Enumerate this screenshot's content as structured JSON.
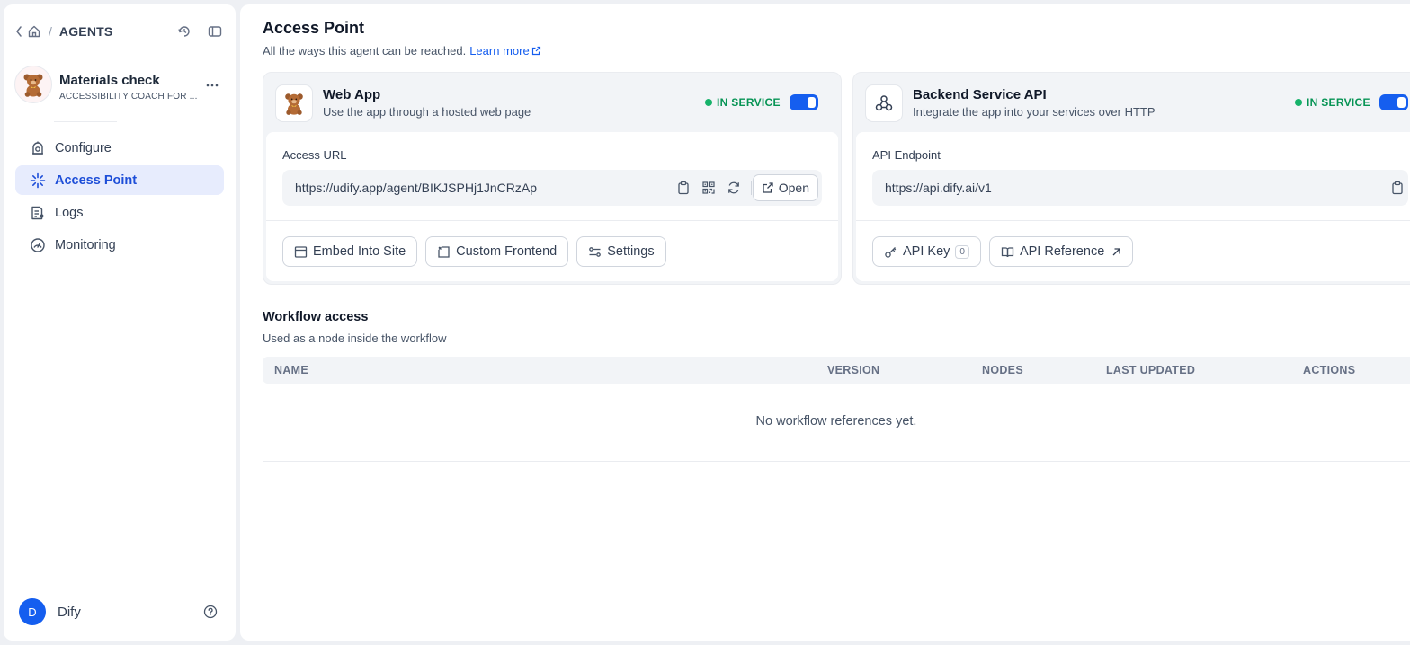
{
  "breadcrumb": {
    "section": "AGENTS"
  },
  "app": {
    "name": "Materials check",
    "subtitle": "ACCESSIBILITY COACH FOR ..."
  },
  "nav": [
    {
      "label": "Configure"
    },
    {
      "label": "Access Point"
    },
    {
      "label": "Logs"
    },
    {
      "label": "Monitoring"
    }
  ],
  "user": {
    "initial": "D",
    "name": "Dify"
  },
  "page": {
    "title": "Access Point",
    "description": "All the ways this agent can be reached.",
    "learn_more": "Learn more"
  },
  "web_app": {
    "title": "Web App",
    "subtitle": "Use the app through a hosted web page",
    "status": "IN SERVICE",
    "enabled": true,
    "field_label": "Access URL",
    "url": "https://udify.app/agent/BIKJSPHj1JnCRzAp",
    "open_label": "Open",
    "buttons": {
      "embed": "Embed Into Site",
      "custom_frontend": "Custom Frontend",
      "settings": "Settings"
    }
  },
  "backend_api": {
    "title": "Backend Service API",
    "subtitle": "Integrate the app into your services over HTTP",
    "status": "IN SERVICE",
    "enabled": true,
    "field_label": "API Endpoint",
    "endpoint": "https://api.dify.ai/v1",
    "buttons": {
      "api_key": "API Key",
      "api_key_count": "0",
      "api_reference": "API Reference"
    }
  },
  "workflow": {
    "title": "Workflow access",
    "description": "Used as a node inside the workflow",
    "columns": {
      "name": "NAME",
      "version": "VERSION",
      "nodes": "NODES",
      "last_updated": "LAST UPDATED",
      "actions": "ACTIONS"
    },
    "empty_text": "No workflow references yet."
  },
  "colors": {
    "accent": "#155eef",
    "active_bg": "#e7ecfd",
    "status_green": "#079455"
  }
}
